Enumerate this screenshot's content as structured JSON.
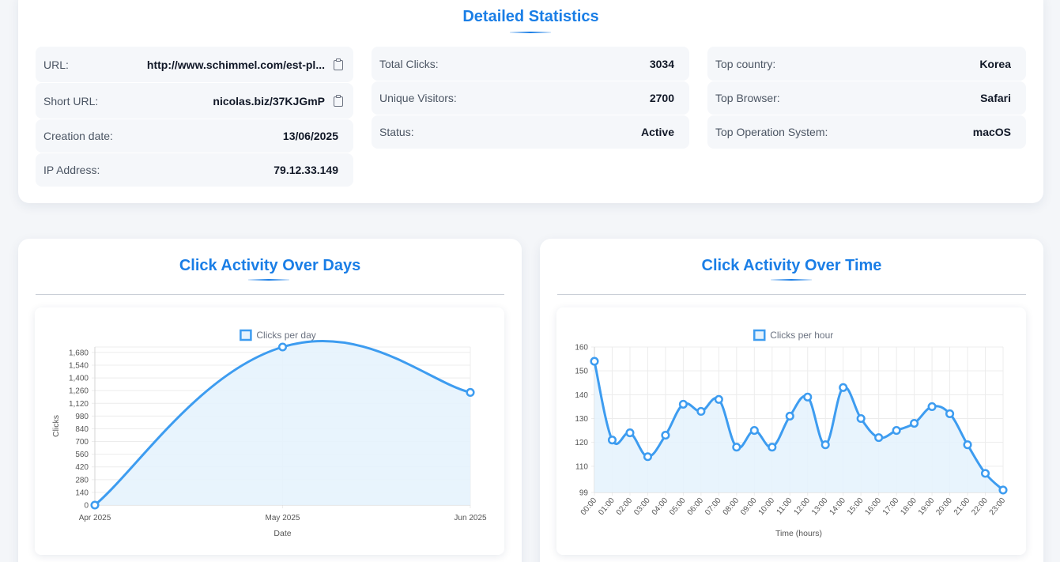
{
  "stats": {
    "title": "Detailed Statistics",
    "url": {
      "label": "URL:",
      "value": "http://www.schimmel.com/est-pl..."
    },
    "short_url": {
      "label": "Short URL:",
      "value": "nicolas.biz/37KJGmP"
    },
    "creation_date": {
      "label": "Creation date:",
      "value": "13/06/2025"
    },
    "ip_address": {
      "label": "IP Address:",
      "value": "79.12.33.149"
    },
    "total_clicks": {
      "label": "Total Clicks:",
      "value": "3034"
    },
    "unique_visitors": {
      "label": "Unique Visitors:",
      "value": "2700"
    },
    "status": {
      "label": "Status:",
      "value": "Active"
    },
    "top_country": {
      "label": "Top country:",
      "value": "Korea"
    },
    "top_browser": {
      "label": "Top Browser:",
      "value": "Safari"
    },
    "top_os": {
      "label": "Top Operation System:",
      "value": "macOS"
    },
    "copy_icon": "clipboard-icon"
  },
  "days_card": {
    "title": "Click Activity Over Days"
  },
  "time_card": {
    "title": "Click Activity Over Time"
  },
  "colors": {
    "accent": "#1a7ee6",
    "line": "#3d9cf0",
    "fill": "#e6f3fd"
  },
  "chart_data": [
    {
      "type": "area",
      "legend": "Clicks per day",
      "xlabel": "Date",
      "ylabel": "Clicks",
      "categories": [
        "Apr 2025",
        "May 2025",
        "Jun 2025"
      ],
      "series": [
        {
          "name": "Clicks per day",
          "values": [
            0,
            1740,
            1240
          ]
        }
      ],
      "yticks": [
        0,
        140,
        280,
        420,
        560,
        700,
        840,
        980,
        1120,
        1260,
        1400,
        1540,
        1680
      ],
      "ylim": [
        0,
        1740
      ],
      "grid": true,
      "legend_position": "top"
    },
    {
      "type": "area",
      "legend": "Clicks per hour",
      "xlabel": "Time (hours)",
      "ylabel": "",
      "categories": [
        "00:00",
        "01:00",
        "02:00",
        "03:00",
        "04:00",
        "05:00",
        "06:00",
        "07:00",
        "08:00",
        "09:00",
        "10:00",
        "11:00",
        "12:00",
        "13:00",
        "14:00",
        "15:00",
        "16:00",
        "17:00",
        "18:00",
        "19:00",
        "20:00",
        "21:00",
        "22:00",
        "23:00"
      ],
      "series": [
        {
          "name": "Clicks per hour",
          "values": [
            154,
            121,
            124,
            114,
            123,
            136,
            133,
            138,
            118,
            125,
            118,
            131,
            139,
            119,
            143,
            130,
            122,
            125,
            128,
            135,
            132,
            119,
            107,
            100
          ]
        }
      ],
      "yticks": [
        99,
        110,
        120,
        130,
        140,
        150,
        160
      ],
      "ylim": [
        99,
        160
      ],
      "grid": true,
      "legend_position": "top"
    }
  ]
}
